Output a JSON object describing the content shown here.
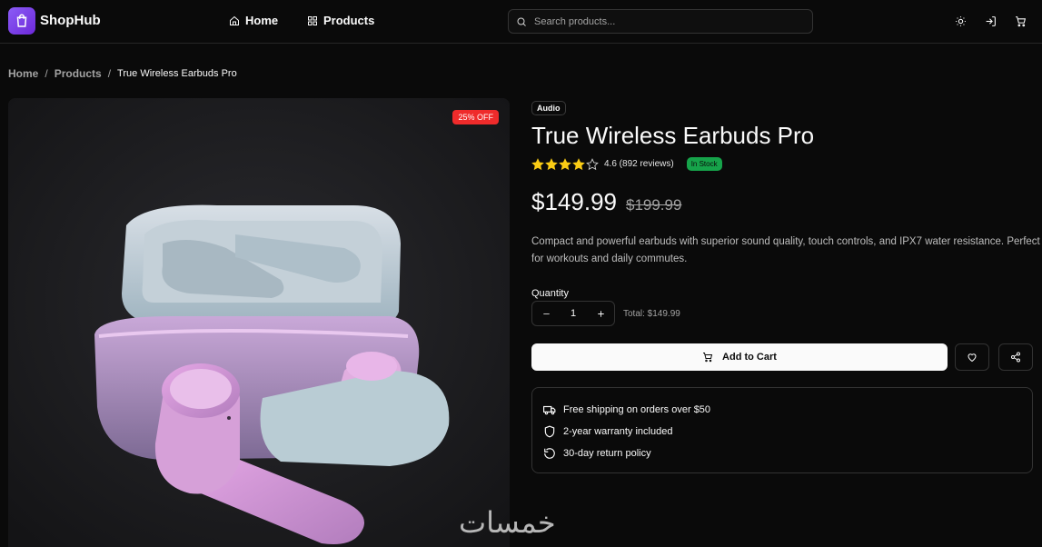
{
  "header": {
    "logo": "ShopHub",
    "nav": [
      {
        "label": "Home",
        "icon": "home-icon"
      },
      {
        "label": "Products",
        "icon": "grid-icon"
      }
    ],
    "search_placeholder": "Search products...",
    "icons": [
      "sun-icon",
      "login-icon",
      "cart-icon"
    ]
  },
  "breadcrumb": {
    "items": [
      "Home",
      "Products"
    ],
    "current": "True Wireless Earbuds Pro",
    "separator": "/"
  },
  "product": {
    "discount_badge": "25% OFF",
    "category": "Audio",
    "title": "True Wireless Earbuds Pro",
    "rating": 4.6,
    "rating_text": "4.6 (892 reviews)",
    "stock": "In Stock",
    "price": "$149.99",
    "old_price": "$199.99",
    "description": "Compact and powerful earbuds with superior sound quality, touch controls, and IPX7 water resistance. Perfect for workouts and daily commutes.",
    "quantity_label": "Quantity",
    "quantity": "1",
    "total": "Total: $149.99",
    "add_to_cart": "Add to Cart"
  },
  "features": [
    {
      "icon": "truck-icon",
      "text": "Free shipping on orders over $50"
    },
    {
      "icon": "shield-icon",
      "text": "2-year warranty included"
    },
    {
      "icon": "return-icon",
      "text": "30-day return policy"
    }
  ],
  "colors": {
    "accent": "#7c3aed",
    "discount": "#ef2b2b",
    "stock": "#16a34a",
    "star": "#facc15"
  },
  "watermark": "خمسات"
}
